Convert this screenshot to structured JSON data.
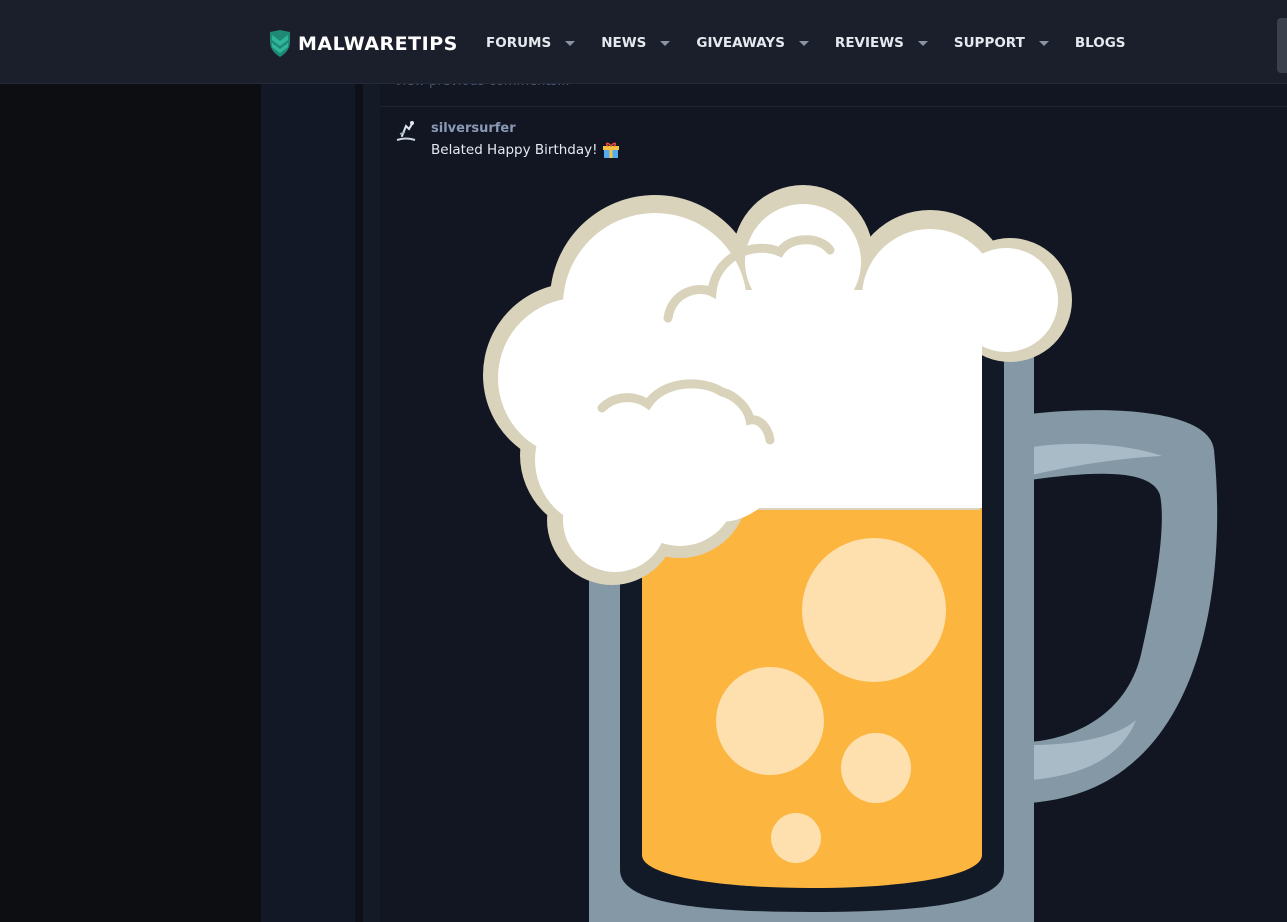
{
  "header": {
    "brand_name": "MALWARETIPS",
    "nav": [
      {
        "label": "FORUMS",
        "has_dropdown": true
      },
      {
        "label": "NEWS",
        "has_dropdown": true
      },
      {
        "label": "GIVEAWAYS",
        "has_dropdown": true
      },
      {
        "label": "REVIEWS",
        "has_dropdown": true
      },
      {
        "label": "SUPPORT",
        "has_dropdown": true
      },
      {
        "label": "BLOGS",
        "has_dropdown": false
      }
    ]
  },
  "comments": {
    "view_previous_label": "View previous comments...",
    "items": [
      {
        "username": "silversurfer",
        "text": "Belated Happy Birthday!",
        "emoji_icon": "gift-icon",
        "image_icon": "beer-mug-icon"
      }
    ]
  },
  "colors": {
    "header_bg": "#1a1f2b",
    "page_bg": "#111622",
    "brand_accent": "#2fb69a",
    "username": "#8b9ab6",
    "beer": "#fcb53f",
    "foam": "#ffffff",
    "mug": "#8598a6"
  }
}
